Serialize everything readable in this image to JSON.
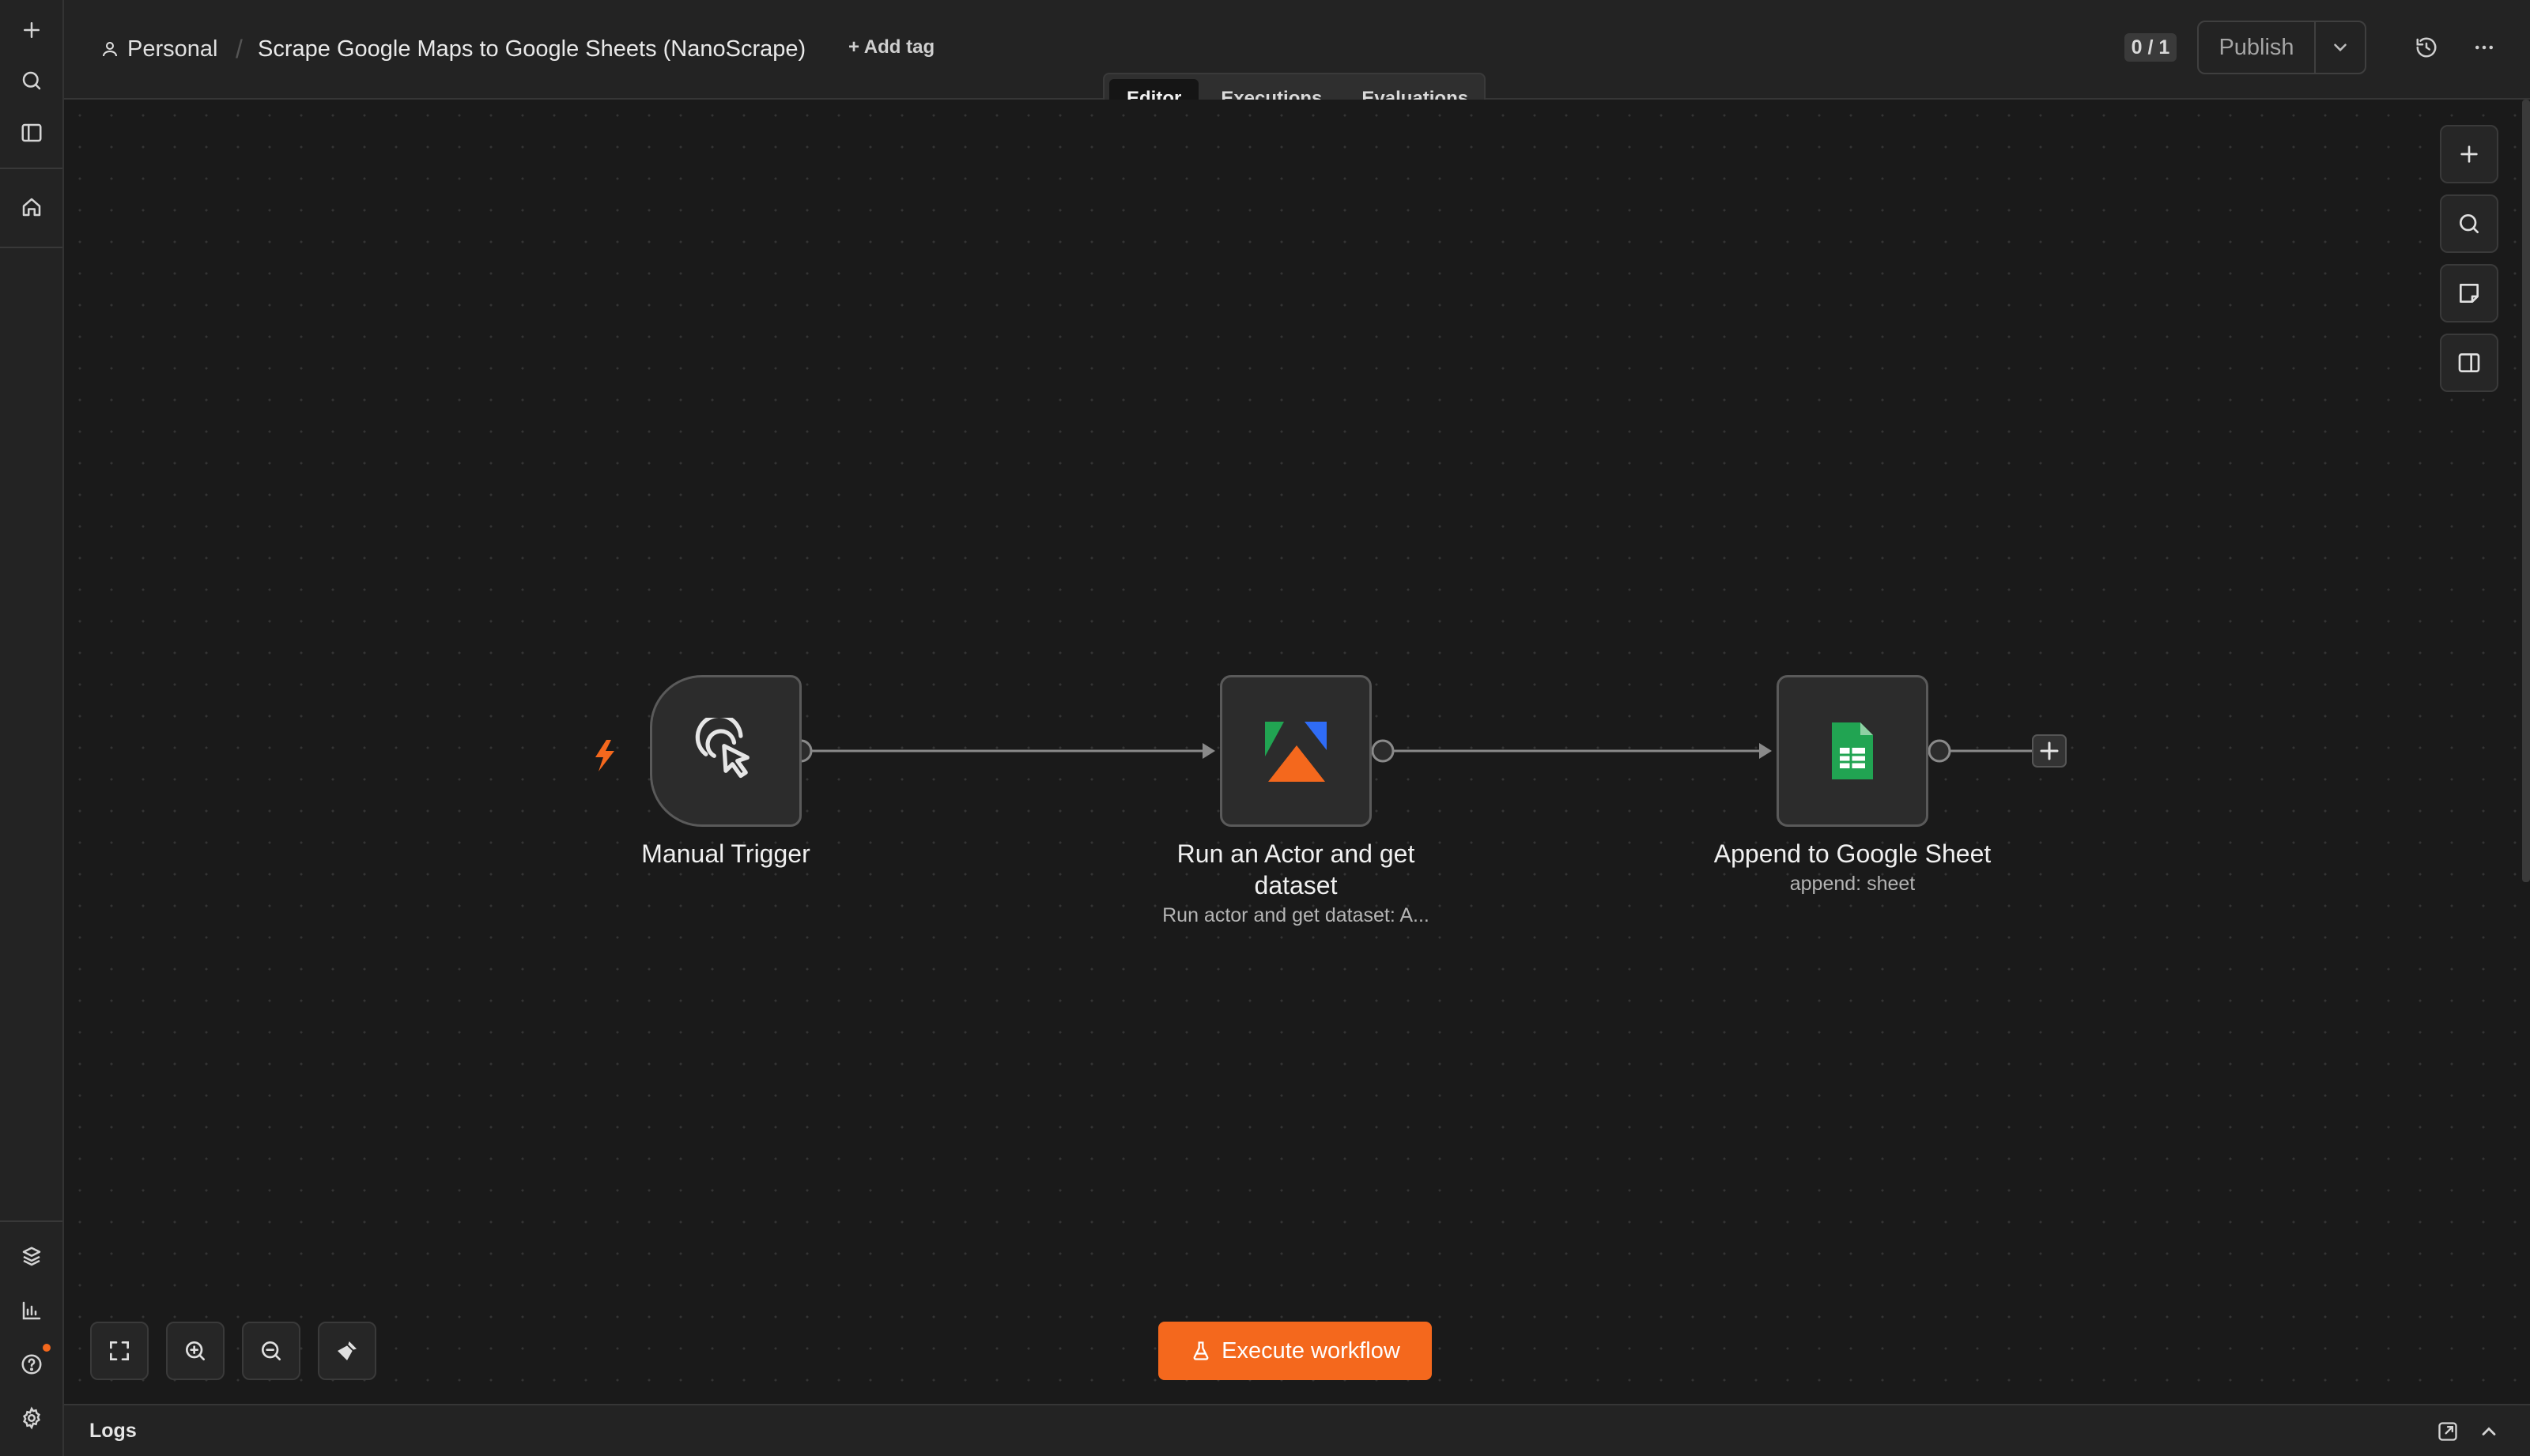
{
  "app": {
    "colors": {
      "accent": "#f4681d",
      "background": "#1a1a1a",
      "panel": "#232323"
    }
  },
  "sidebar": {
    "top_icons": [
      "plus-icon",
      "search-icon",
      "panel-toggle-icon",
      "home-icon"
    ],
    "bottom_icons": [
      "templates-icon",
      "insights-icon",
      "help-icon",
      "settings-icon"
    ]
  },
  "header": {
    "project": "Personal",
    "workflow_title": "Scrape Google Maps to Google Sheets (NanoScrape)",
    "add_tag": "+ Add tag",
    "counter": "0 / 1",
    "publish_label": "Publish"
  },
  "tabs": [
    {
      "label": "Editor",
      "active": true
    },
    {
      "label": "Executions",
      "active": false
    },
    {
      "label": "Evaluations",
      "active": false
    }
  ],
  "nodes": [
    {
      "label": "Manual Trigger",
      "subtitle": ""
    },
    {
      "label_line1": "Run an Actor and get",
      "label_line2": "dataset",
      "subtitle": "Run actor and get dataset: A..."
    },
    {
      "label": "Append to Google Sheet",
      "subtitle": "append: sheet"
    }
  ],
  "canvas": {
    "execute_label": "Execute workflow"
  },
  "logs": {
    "title": "Logs"
  }
}
